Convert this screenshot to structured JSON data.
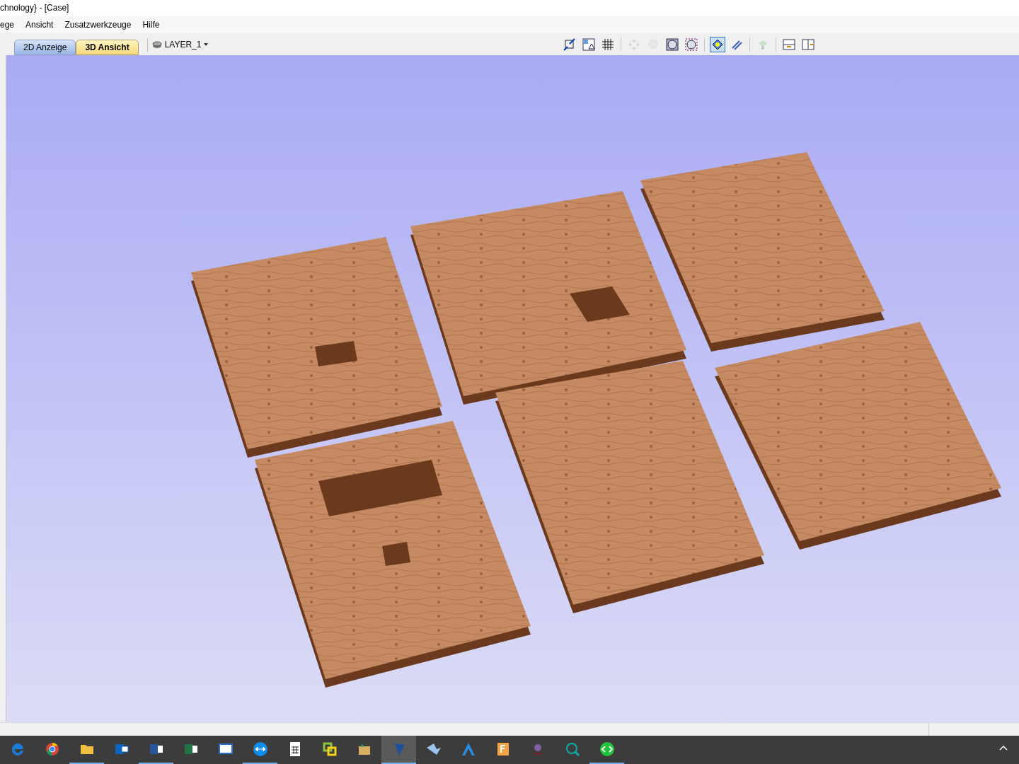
{
  "window": {
    "title": "chnology} - [Case]"
  },
  "menu": [
    "ege",
    "Ansicht",
    "Zusatzwerkzeuge",
    "Hilfe"
  ],
  "view_tabs": [
    {
      "label": "2D Anzeige",
      "selected": false
    },
    {
      "label": "3D Ansicht",
      "selected": true
    }
  ],
  "layer": {
    "label": "LAYER_1"
  },
  "toolbar": [
    {
      "disabled": false,
      "selected": false
    },
    {
      "disabled": false,
      "selected": false
    },
    {
      "disabled": false,
      "selected": false
    },
    {
      "disabled": true,
      "selected": false
    },
    {
      "disabled": true,
      "selected": false
    },
    {
      "disabled": false,
      "selected": false
    },
    {
      "disabled": false,
      "selected": false
    },
    {
      "disabled": false,
      "selected": true
    },
    {
      "disabled": false,
      "selected": false
    },
    {
      "disabled": true,
      "selected": false
    },
    {
      "disabled": false,
      "selected": false
    },
    {
      "disabled": false,
      "selected": false
    }
  ],
  "taskbar": [
    {
      "running": false,
      "selected": false
    },
    {
      "running": false,
      "selected": false
    },
    {
      "running": true,
      "selected": false
    },
    {
      "running": false,
      "selected": false
    },
    {
      "running": true,
      "selected": false
    },
    {
      "running": false,
      "selected": false
    },
    {
      "running": false,
      "selected": false
    },
    {
      "running": true,
      "selected": false
    },
    {
      "running": false,
      "selected": false
    },
    {
      "running": false,
      "selected": false
    },
    {
      "running": false,
      "selected": false
    },
    {
      "running": true,
      "selected": true
    },
    {
      "running": false,
      "selected": false
    },
    {
      "running": false,
      "selected": false
    },
    {
      "running": false,
      "selected": false
    },
    {
      "running": false,
      "selected": false
    },
    {
      "running": false,
      "selected": false
    },
    {
      "running": true,
      "selected": false
    }
  ]
}
